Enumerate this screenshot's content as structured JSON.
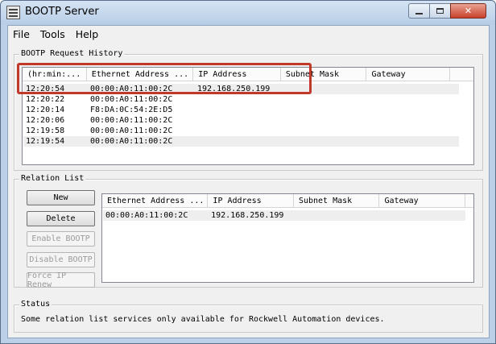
{
  "window": {
    "title": "BOOTP Server",
    "icon": "app-list-icon"
  },
  "menu": [
    "File",
    "Tools",
    "Help"
  ],
  "history": {
    "title": "BOOTP Request History",
    "columns": [
      "(hr:min:...",
      "Ethernet Address ...",
      "IP Address",
      "Subnet Mask",
      "Gateway"
    ],
    "rows": [
      {
        "time": "12:20:54",
        "mac": "00:00:A0:11:00:2C",
        "ip": "192.168.250.199",
        "mask": "",
        "gateway": ""
      },
      {
        "time": "12:20:22",
        "mac": "00:00:A0:11:00:2C",
        "ip": "",
        "mask": "",
        "gateway": ""
      },
      {
        "time": "12:20:14",
        "mac": "F8:DA:0C:54:2E:D5",
        "ip": "",
        "mask": "",
        "gateway": ""
      },
      {
        "time": "12:20:06",
        "mac": "00:00:A0:11:00:2C",
        "ip": "",
        "mask": "",
        "gateway": ""
      },
      {
        "time": "12:19:58",
        "mac": "00:00:A0:11:00:2C",
        "ip": "",
        "mask": "",
        "gateway": ""
      },
      {
        "time": "12:19:54",
        "mac": "00:00:A0:11:00:2C",
        "ip": "",
        "mask": "",
        "gateway": ""
      }
    ]
  },
  "relation": {
    "title": "Relation List",
    "buttons": {
      "new": "New",
      "delete": "Delete",
      "enable": "Enable BOOTP",
      "disable": "Disable BOOTP",
      "force": "Force IP Renew"
    },
    "columns": [
      "Ethernet Address ...",
      "IP Address",
      "Subnet Mask",
      "Gateway"
    ],
    "rows": [
      {
        "mac": "00:00:A0:11:00:2C",
        "ip": "192.168.250.199",
        "mask": "",
        "gateway": ""
      }
    ]
  },
  "status": {
    "title": "Status",
    "text": "Some relation list services only available for Rockwell Automation devices."
  },
  "colors": {
    "highlight": "#c0392b",
    "selected_row": "#eeeeee"
  }
}
